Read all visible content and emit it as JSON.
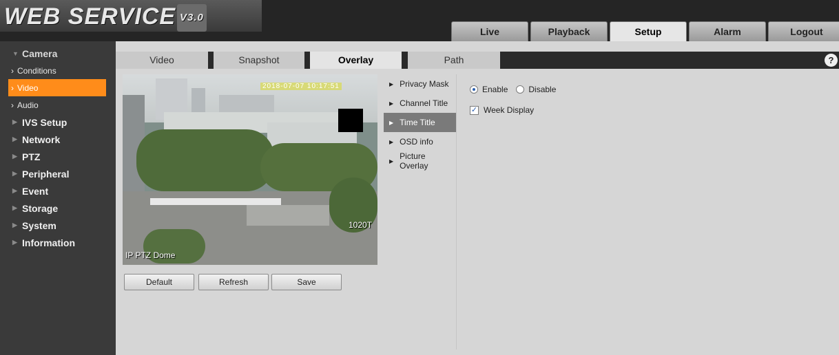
{
  "header": {
    "logo_text": "WEB SERVICE",
    "logo_version": "V3.0",
    "tabs": [
      {
        "label": "Live"
      },
      {
        "label": "Playback"
      },
      {
        "label": "Setup"
      },
      {
        "label": "Alarm"
      },
      {
        "label": "Logout"
      }
    ],
    "active_tab": "Setup"
  },
  "sidebar": {
    "camera_label": "Camera",
    "sub_items": [
      {
        "label": "Conditions"
      },
      {
        "label": "Video"
      },
      {
        "label": "Audio"
      }
    ],
    "active_sub": "Video",
    "items": [
      {
        "label": "IVS Setup"
      },
      {
        "label": "Network"
      },
      {
        "label": "PTZ"
      },
      {
        "label": "Peripheral"
      },
      {
        "label": "Event"
      },
      {
        "label": "Storage"
      },
      {
        "label": "System"
      },
      {
        "label": "Information"
      }
    ]
  },
  "subtabs": [
    {
      "label": "Video"
    },
    {
      "label": "Snapshot"
    },
    {
      "label": "Overlay"
    },
    {
      "label": "Path"
    }
  ],
  "active_subtab": "Overlay",
  "help_label": "?",
  "preview": {
    "timestamp": "2018-07-07 10:17:51",
    "camera_title": "IP PTZ Dome",
    "channel_number": "1020T"
  },
  "buttons": {
    "default": "Default",
    "refresh": "Refresh",
    "save": "Save"
  },
  "overlay_menu": [
    {
      "label": "Privacy Mask"
    },
    {
      "label": "Channel Title"
    },
    {
      "label": "Time Title"
    },
    {
      "label": "OSD info"
    },
    {
      "label": "Picture Overlay"
    }
  ],
  "active_overlay_item": "Time Title",
  "settings": {
    "enable_label": "Enable",
    "disable_label": "Disable",
    "selected": "Enable",
    "week_display_label": "Week Display",
    "week_display_checked": true
  },
  "colors": {
    "accent": "#ff8c1a",
    "header_bg": "#252525",
    "sidebar_bg": "#3a3a3a",
    "content_bg": "#d6d6d6"
  }
}
